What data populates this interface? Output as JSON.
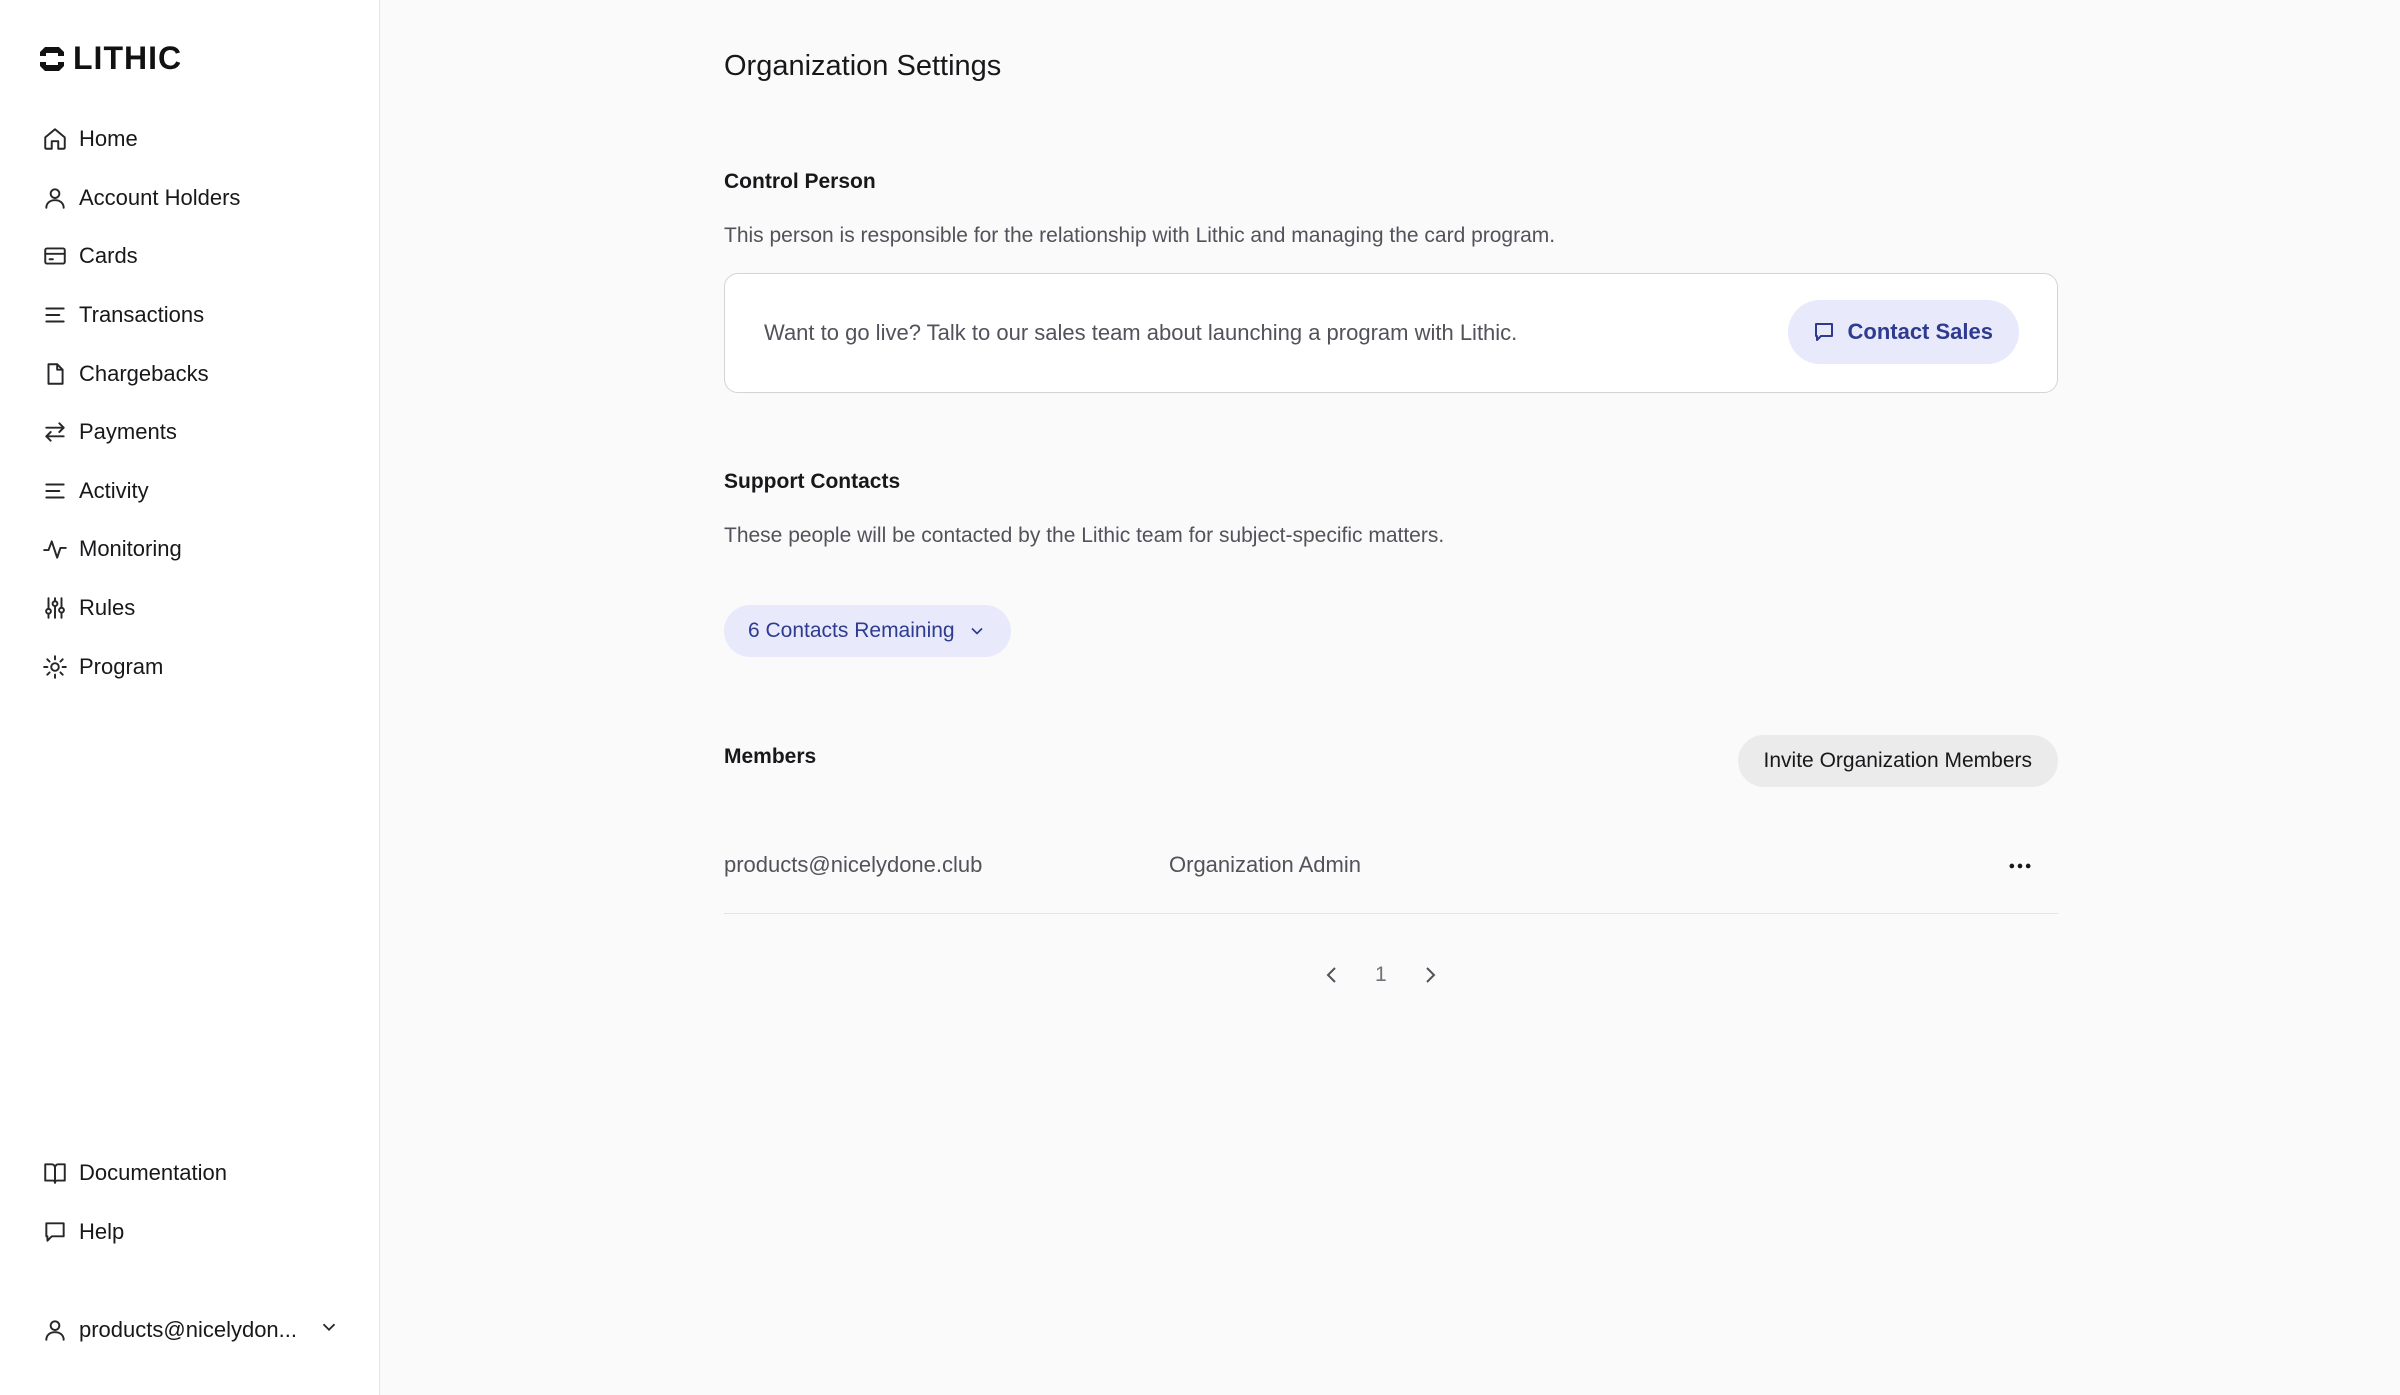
{
  "brand": {
    "name": "LITHIC"
  },
  "sidebar": {
    "items": [
      {
        "label": "Home",
        "icon": "home-icon"
      },
      {
        "label": "Account Holders",
        "icon": "user-icon"
      },
      {
        "label": "Cards",
        "icon": "card-icon"
      },
      {
        "label": "Transactions",
        "icon": "list-icon"
      },
      {
        "label": "Chargebacks",
        "icon": "document-icon"
      },
      {
        "label": "Payments",
        "icon": "swap-arrows-icon"
      },
      {
        "label": "Activity",
        "icon": "list-icon"
      },
      {
        "label": "Monitoring",
        "icon": "pulse-icon"
      },
      {
        "label": "Rules",
        "icon": "sliders-icon"
      },
      {
        "label": "Program",
        "icon": "gear-icon"
      }
    ],
    "bottom_items": [
      {
        "label": "Documentation",
        "icon": "book-icon"
      },
      {
        "label": "Help",
        "icon": "chat-icon"
      }
    ],
    "user": {
      "label": "products@nicelydon...",
      "icon": "user-icon"
    }
  },
  "main": {
    "title": "Organization Settings",
    "control_person": {
      "title": "Control Person",
      "description": "This person is responsible for the relationship with Lithic and managing the card program.",
      "cta_text": "Want to go live? Talk to our sales team about launching a program with Lithic.",
      "cta_button": "Contact Sales"
    },
    "support_contacts": {
      "title": "Support Contacts",
      "description": "These people will be contacted by the Lithic team for subject-specific matters.",
      "dropdown_label": "6 Contacts Remaining"
    },
    "members": {
      "title": "Members",
      "invite_button": "Invite Organization Members",
      "rows": [
        {
          "email": "products@nicelydone.club",
          "role": "Organization Admin"
        }
      ]
    },
    "pagination": {
      "current_page": "1"
    }
  },
  "colors": {
    "accent_bg": "#e8eafb",
    "accent_text": "#2e3b8f",
    "page_bg": "#fafafa"
  }
}
